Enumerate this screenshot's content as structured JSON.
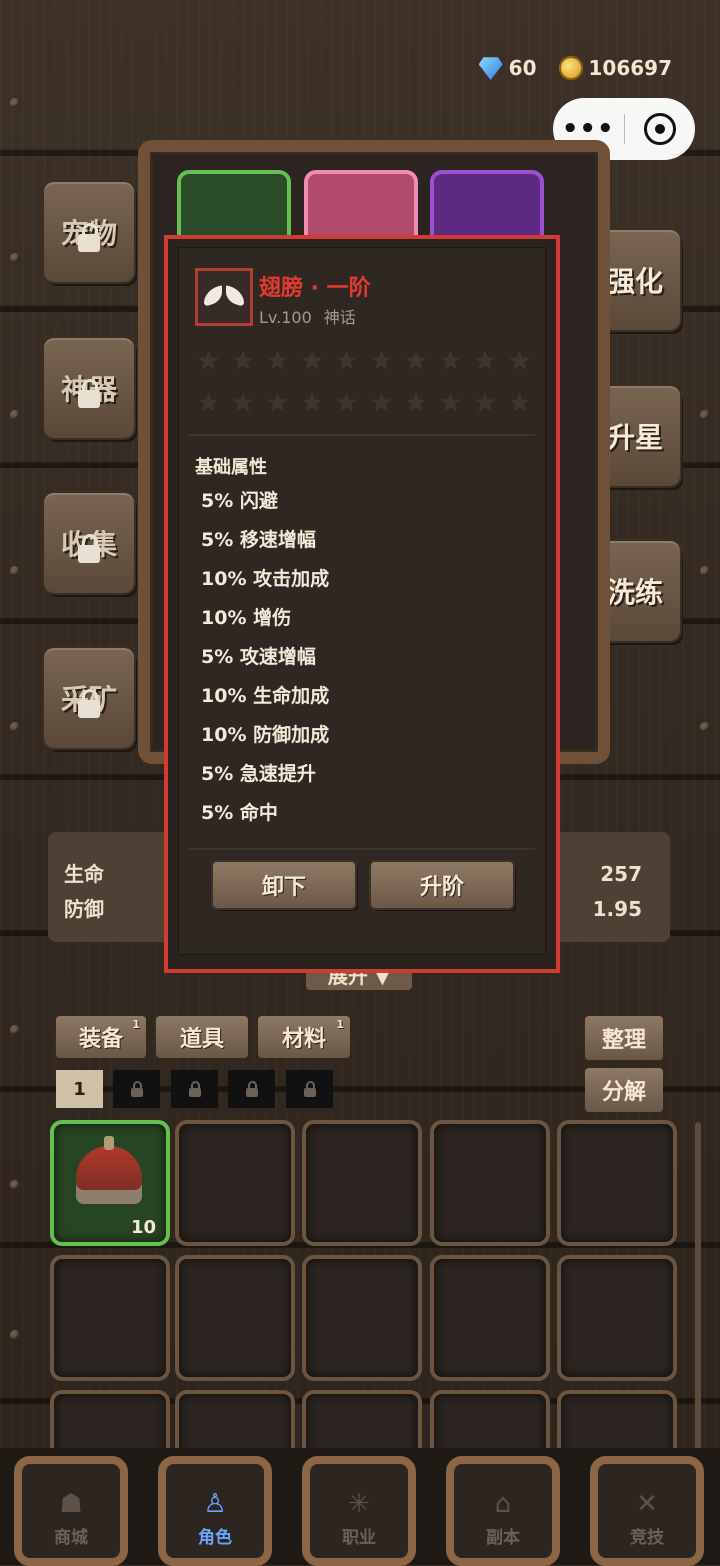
{
  "currency": {
    "gems": "60",
    "gold": "106697"
  },
  "capsule": {
    "menu_glyph": "•••"
  },
  "side_left": [
    "宠物",
    "神器",
    "收集",
    "采矿"
  ],
  "side_right": [
    "强化",
    "升星",
    "洗练"
  ],
  "stats": {
    "hp_label": "生命",
    "def_label": "防御",
    "hp_value": "257",
    "def_value": "1.95",
    "expand": "展开 ▼"
  },
  "popup": {
    "name": "翅膀 · 一阶",
    "level": "Lv.100",
    "rarity": "神话",
    "star_count": 20,
    "attr_title": "基础属性",
    "attrs": [
      "5% 闪避",
      "5% 移速增幅",
      "10% 攻击加成",
      "10% 增伤",
      "5% 攻速增幅",
      "10% 生命加成",
      "10% 防御加成",
      "5% 急速提升",
      "5% 命中"
    ],
    "unequip": "卸下",
    "upgrade": "升阶"
  },
  "inventory": {
    "tabs": [
      {
        "label": "装备",
        "badge": "1"
      },
      {
        "label": "道具",
        "badge": ""
      },
      {
        "label": "材料",
        "badge": "1"
      }
    ],
    "sort": "整理",
    "decompose": "分解",
    "page": "1",
    "first_item_count": "10"
  },
  "nav": [
    "商城",
    "角色",
    "职业",
    "副本",
    "竞技"
  ],
  "colors": {
    "accent_red": "#e23a33",
    "slot_green": "#65c04f",
    "nav_active": "#6aa4ff"
  }
}
